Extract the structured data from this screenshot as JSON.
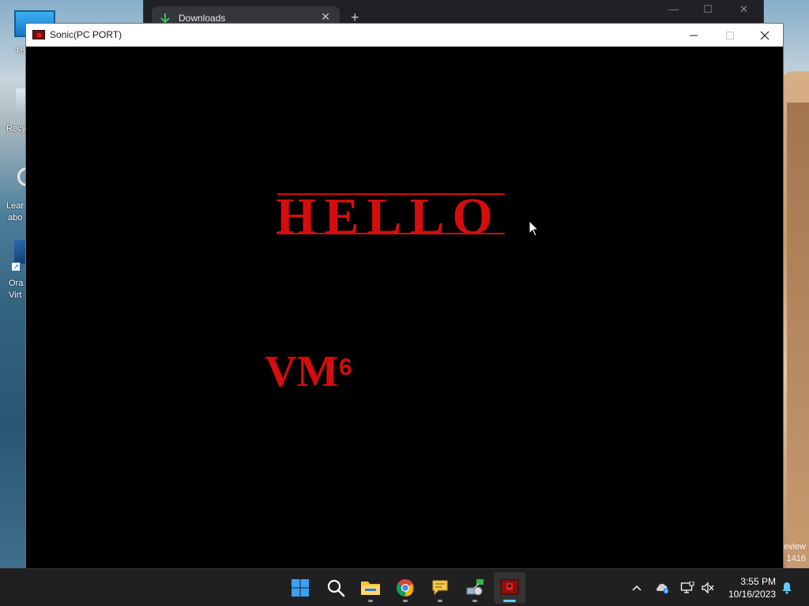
{
  "desktop": {
    "icons": [
      {
        "label": "Th",
        "icon": "this-pc-icon"
      },
      {
        "label": "Recy",
        "icon": "recycle-bin-icon"
      },
      {
        "label_line1": "Lear",
        "label_line2": "abo",
        "icon": "learn-about-icon"
      },
      {
        "label_line1": "Ora",
        "label_line2": "Virt",
        "icon": "oracle-virtualbox-icon"
      }
    ],
    "watermark_line1": "eview",
    "watermark_line2": "1416"
  },
  "background_window": {
    "tab_title": "Downloads",
    "tab_icon": "download-icon",
    "new_tab_symbol": "+"
  },
  "game_window": {
    "title": "Sonic(PC PORT)",
    "icon": "sonic-app-icon",
    "hello_text": "HELLO",
    "vm_text": "VM",
    "vm_superscript": "6",
    "text_color": "#d40d0d"
  },
  "taskbar": {
    "items": [
      {
        "name": "start",
        "icon": "windows-start-icon"
      },
      {
        "name": "search",
        "icon": "search-icon"
      },
      {
        "name": "file-explorer",
        "icon": "folder-icon"
      },
      {
        "name": "chrome",
        "icon": "chrome-icon"
      },
      {
        "name": "chat",
        "icon": "chat-bubble-icon"
      },
      {
        "name": "network-app",
        "icon": "network-app-icon"
      },
      {
        "name": "sonic-pc-port",
        "icon": "sonic-app-icon",
        "active": true
      }
    ],
    "tray": {
      "icons": [
        "chevron-up-icon",
        "onedrive-icon",
        "network-icon",
        "volume-muted-icon",
        "notification-bell-icon"
      ]
    },
    "time": "3:55 PM",
    "date": "10/16/2023"
  },
  "colors": {
    "taskbar_bg": "#202020",
    "accent": "#60cdff",
    "title_bar_bg": "#ffffff"
  }
}
